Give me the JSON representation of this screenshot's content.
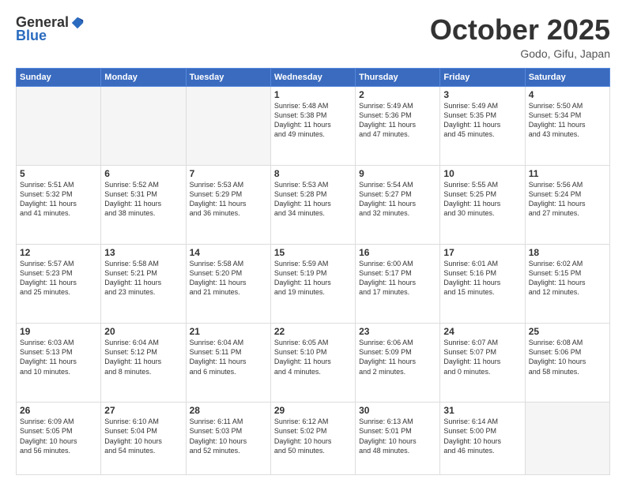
{
  "header": {
    "logo_general": "General",
    "logo_blue": "Blue",
    "month": "October 2025",
    "location": "Godo, Gifu, Japan"
  },
  "weekdays": [
    "Sunday",
    "Monday",
    "Tuesday",
    "Wednesday",
    "Thursday",
    "Friday",
    "Saturday"
  ],
  "weeks": [
    [
      {
        "day": "",
        "info": ""
      },
      {
        "day": "",
        "info": ""
      },
      {
        "day": "",
        "info": ""
      },
      {
        "day": "1",
        "info": "Sunrise: 5:48 AM\nSunset: 5:38 PM\nDaylight: 11 hours\nand 49 minutes."
      },
      {
        "day": "2",
        "info": "Sunrise: 5:49 AM\nSunset: 5:36 PM\nDaylight: 11 hours\nand 47 minutes."
      },
      {
        "day": "3",
        "info": "Sunrise: 5:49 AM\nSunset: 5:35 PM\nDaylight: 11 hours\nand 45 minutes."
      },
      {
        "day": "4",
        "info": "Sunrise: 5:50 AM\nSunset: 5:34 PM\nDaylight: 11 hours\nand 43 minutes."
      }
    ],
    [
      {
        "day": "5",
        "info": "Sunrise: 5:51 AM\nSunset: 5:32 PM\nDaylight: 11 hours\nand 41 minutes."
      },
      {
        "day": "6",
        "info": "Sunrise: 5:52 AM\nSunset: 5:31 PM\nDaylight: 11 hours\nand 38 minutes."
      },
      {
        "day": "7",
        "info": "Sunrise: 5:53 AM\nSunset: 5:29 PM\nDaylight: 11 hours\nand 36 minutes."
      },
      {
        "day": "8",
        "info": "Sunrise: 5:53 AM\nSunset: 5:28 PM\nDaylight: 11 hours\nand 34 minutes."
      },
      {
        "day": "9",
        "info": "Sunrise: 5:54 AM\nSunset: 5:27 PM\nDaylight: 11 hours\nand 32 minutes."
      },
      {
        "day": "10",
        "info": "Sunrise: 5:55 AM\nSunset: 5:25 PM\nDaylight: 11 hours\nand 30 minutes."
      },
      {
        "day": "11",
        "info": "Sunrise: 5:56 AM\nSunset: 5:24 PM\nDaylight: 11 hours\nand 27 minutes."
      }
    ],
    [
      {
        "day": "12",
        "info": "Sunrise: 5:57 AM\nSunset: 5:23 PM\nDaylight: 11 hours\nand 25 minutes."
      },
      {
        "day": "13",
        "info": "Sunrise: 5:58 AM\nSunset: 5:21 PM\nDaylight: 11 hours\nand 23 minutes."
      },
      {
        "day": "14",
        "info": "Sunrise: 5:58 AM\nSunset: 5:20 PM\nDaylight: 11 hours\nand 21 minutes."
      },
      {
        "day": "15",
        "info": "Sunrise: 5:59 AM\nSunset: 5:19 PM\nDaylight: 11 hours\nand 19 minutes."
      },
      {
        "day": "16",
        "info": "Sunrise: 6:00 AM\nSunset: 5:17 PM\nDaylight: 11 hours\nand 17 minutes."
      },
      {
        "day": "17",
        "info": "Sunrise: 6:01 AM\nSunset: 5:16 PM\nDaylight: 11 hours\nand 15 minutes."
      },
      {
        "day": "18",
        "info": "Sunrise: 6:02 AM\nSunset: 5:15 PM\nDaylight: 11 hours\nand 12 minutes."
      }
    ],
    [
      {
        "day": "19",
        "info": "Sunrise: 6:03 AM\nSunset: 5:13 PM\nDaylight: 11 hours\nand 10 minutes."
      },
      {
        "day": "20",
        "info": "Sunrise: 6:04 AM\nSunset: 5:12 PM\nDaylight: 11 hours\nand 8 minutes."
      },
      {
        "day": "21",
        "info": "Sunrise: 6:04 AM\nSunset: 5:11 PM\nDaylight: 11 hours\nand 6 minutes."
      },
      {
        "day": "22",
        "info": "Sunrise: 6:05 AM\nSunset: 5:10 PM\nDaylight: 11 hours\nand 4 minutes."
      },
      {
        "day": "23",
        "info": "Sunrise: 6:06 AM\nSunset: 5:09 PM\nDaylight: 11 hours\nand 2 minutes."
      },
      {
        "day": "24",
        "info": "Sunrise: 6:07 AM\nSunset: 5:07 PM\nDaylight: 11 hours\nand 0 minutes."
      },
      {
        "day": "25",
        "info": "Sunrise: 6:08 AM\nSunset: 5:06 PM\nDaylight: 10 hours\nand 58 minutes."
      }
    ],
    [
      {
        "day": "26",
        "info": "Sunrise: 6:09 AM\nSunset: 5:05 PM\nDaylight: 10 hours\nand 56 minutes."
      },
      {
        "day": "27",
        "info": "Sunrise: 6:10 AM\nSunset: 5:04 PM\nDaylight: 10 hours\nand 54 minutes."
      },
      {
        "day": "28",
        "info": "Sunrise: 6:11 AM\nSunset: 5:03 PM\nDaylight: 10 hours\nand 52 minutes."
      },
      {
        "day": "29",
        "info": "Sunrise: 6:12 AM\nSunset: 5:02 PM\nDaylight: 10 hours\nand 50 minutes."
      },
      {
        "day": "30",
        "info": "Sunrise: 6:13 AM\nSunset: 5:01 PM\nDaylight: 10 hours\nand 48 minutes."
      },
      {
        "day": "31",
        "info": "Sunrise: 6:14 AM\nSunset: 5:00 PM\nDaylight: 10 hours\nand 46 minutes."
      },
      {
        "day": "",
        "info": ""
      }
    ]
  ]
}
